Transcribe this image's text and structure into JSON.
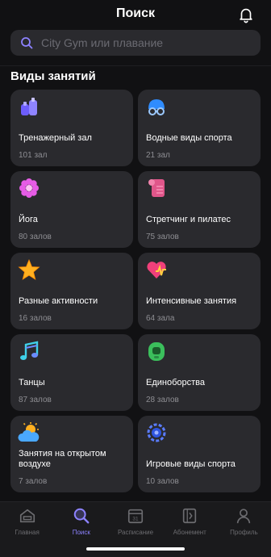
{
  "header": {
    "title": "Поиск"
  },
  "search": {
    "placeholder": "City Gym или плавание"
  },
  "section_title": "Виды занятий",
  "categories": [
    {
      "name": "Тренажерный зал",
      "count": "101 зал",
      "icon": "dumbbell-icon"
    },
    {
      "name": "Водные виды спорта",
      "count": "21 зал",
      "icon": "swim-goggles-icon"
    },
    {
      "name": "Йога",
      "count": "80 залов",
      "icon": "lotus-icon"
    },
    {
      "name": "Стретчинг и пилатес",
      "count": "75 залов",
      "icon": "yoga-mat-icon"
    },
    {
      "name": "Разные активности",
      "count": "16 залов",
      "icon": "star-icon"
    },
    {
      "name": "Интенсивные занятия",
      "count": "64 зала",
      "icon": "heart-pulse-icon"
    },
    {
      "name": "Танцы",
      "count": "87 залов",
      "icon": "music-notes-icon"
    },
    {
      "name": "Единоборства",
      "count": "28 залов",
      "icon": "boxing-helmet-icon"
    },
    {
      "name": "Занятия на открытом воздухе",
      "count": "7 залов",
      "icon": "sun-cloud-icon"
    },
    {
      "name": "Игровые виды спорта",
      "count": "10 залов",
      "icon": "sports-ball-icon"
    }
  ],
  "tabbar": {
    "tabs": [
      {
        "label": "Главная",
        "icon": "home-icon"
      },
      {
        "label": "Поиск",
        "icon": "search-icon",
        "active": true
      },
      {
        "label": "Расписание",
        "icon": "calendar-icon"
      },
      {
        "label": "Абонемент",
        "icon": "membership-card-icon"
      },
      {
        "label": "Профиль",
        "icon": "profile-icon"
      }
    ]
  },
  "colors": {
    "background": "#111113",
    "card": "#2a2a2e",
    "accent": "#8d82ff",
    "muted": "#8e8e93"
  }
}
